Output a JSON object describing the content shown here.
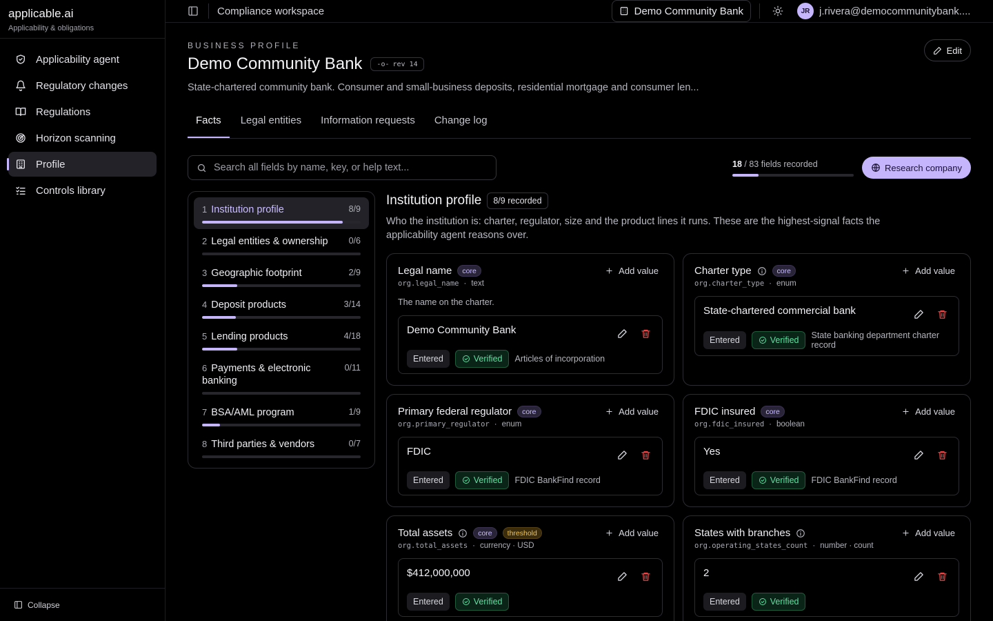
{
  "brand": {
    "name": "applicable.ai",
    "tagline": "Applicability & obligations"
  },
  "nav": [
    {
      "label": "Applicability agent",
      "icon": "shield-icon"
    },
    {
      "label": "Regulatory changes",
      "icon": "bell-icon"
    },
    {
      "label": "Regulations",
      "icon": "book-icon"
    },
    {
      "label": "Horizon scanning",
      "icon": "radar-icon"
    },
    {
      "label": "Profile",
      "icon": "building-icon",
      "active": true
    },
    {
      "label": "Controls library",
      "icon": "checklist-icon"
    }
  ],
  "sidebar_footer": {
    "collapse_label": "Collapse"
  },
  "topbar": {
    "workspace": "Compliance workspace",
    "bank": "Demo Community Bank",
    "avatar_initials": "JR",
    "user_email": "j.rivera@democommunitybank...."
  },
  "header": {
    "eyebrow": "BUSINESS PROFILE",
    "title": "Demo Community Bank",
    "revision": "rev 14",
    "description": "State-chartered community bank. Consumer and small-business deposits, residential mortgage and consumer len...",
    "edit_label": "Edit"
  },
  "tabs": [
    {
      "label": "Facts",
      "active": true
    },
    {
      "label": "Legal entities"
    },
    {
      "label": "Information requests"
    },
    {
      "label": "Change log"
    }
  ],
  "search": {
    "placeholder": "Search all fields by name, key, or help text...",
    "value": ""
  },
  "progress": {
    "recorded": "18",
    "total_text": "/ 83 fields recorded",
    "fraction": 0.217
  },
  "research_label": "Research company",
  "sections": [
    {
      "num": "1",
      "name": "Institution profile",
      "count": "8/9",
      "fraction": 0.889,
      "active": true
    },
    {
      "num": "2",
      "name": "Legal entities & ownership",
      "count": "0/6",
      "fraction": 0
    },
    {
      "num": "3",
      "name": "Geographic footprint",
      "count": "2/9",
      "fraction": 0.222
    },
    {
      "num": "4",
      "name": "Deposit products",
      "count": "3/14",
      "fraction": 0.214
    },
    {
      "num": "5",
      "name": "Lending products",
      "count": "4/18",
      "fraction": 0.222
    },
    {
      "num": "6",
      "name": "Payments & electronic banking",
      "count": "0/11",
      "fraction": 0,
      "tall": true
    },
    {
      "num": "7",
      "name": "BSA/AML program",
      "count": "1/9",
      "fraction": 0.111
    },
    {
      "num": "8",
      "name": "Third parties & vendors",
      "count": "0/7",
      "fraction": 0
    }
  ],
  "detail": {
    "title": "Institution profile",
    "recorded": "8/9 recorded",
    "description": "Who the institution is: charter, regulator, size and the product lines it runs. These are the highest-signal facts the applicability agent reasons over."
  },
  "labels": {
    "add_value": "Add value",
    "entered": "Entered",
    "verified": "Verified",
    "key_sep": "·"
  },
  "cards": [
    {
      "title": "Legal name",
      "info": false,
      "tags": [
        "core"
      ],
      "key": "org.legal_name",
      "type": "text",
      "help": "The name on the charter.",
      "value": "Demo Community Bank",
      "source": "Articles of incorporation"
    },
    {
      "title": "Charter type",
      "info": true,
      "tags": [
        "core"
      ],
      "key": "org.charter_type",
      "type": "enum",
      "help": "",
      "value": "State-chartered commercial bank",
      "source": "State banking department charter record"
    },
    {
      "title": "Primary federal regulator",
      "info": false,
      "tags": [
        "core"
      ],
      "key": "org.primary_regulator",
      "type": "enum",
      "help": "",
      "value": "FDIC",
      "source": "FDIC BankFind record"
    },
    {
      "title": "FDIC insured",
      "info": false,
      "tags": [
        "core"
      ],
      "key": "org.fdic_insured",
      "type": "boolean",
      "help": "",
      "value": "Yes",
      "source": "FDIC BankFind record"
    },
    {
      "title": "Total assets",
      "info": true,
      "tags": [
        "core",
        "threshold"
      ],
      "key": "org.total_assets",
      "type": "currency · USD",
      "help": "",
      "value": "$412,000,000",
      "source": ""
    },
    {
      "title": "States with branches",
      "info": true,
      "tags": [],
      "key": "org.operating_states_count",
      "type": "number · count",
      "help": "",
      "value": "2",
      "source": ""
    }
  ],
  "colors": {
    "accent": "#c4b5fd",
    "danger": "#ef4444",
    "success": "#5ee0a0",
    "threshold": "#f2c14e"
  }
}
